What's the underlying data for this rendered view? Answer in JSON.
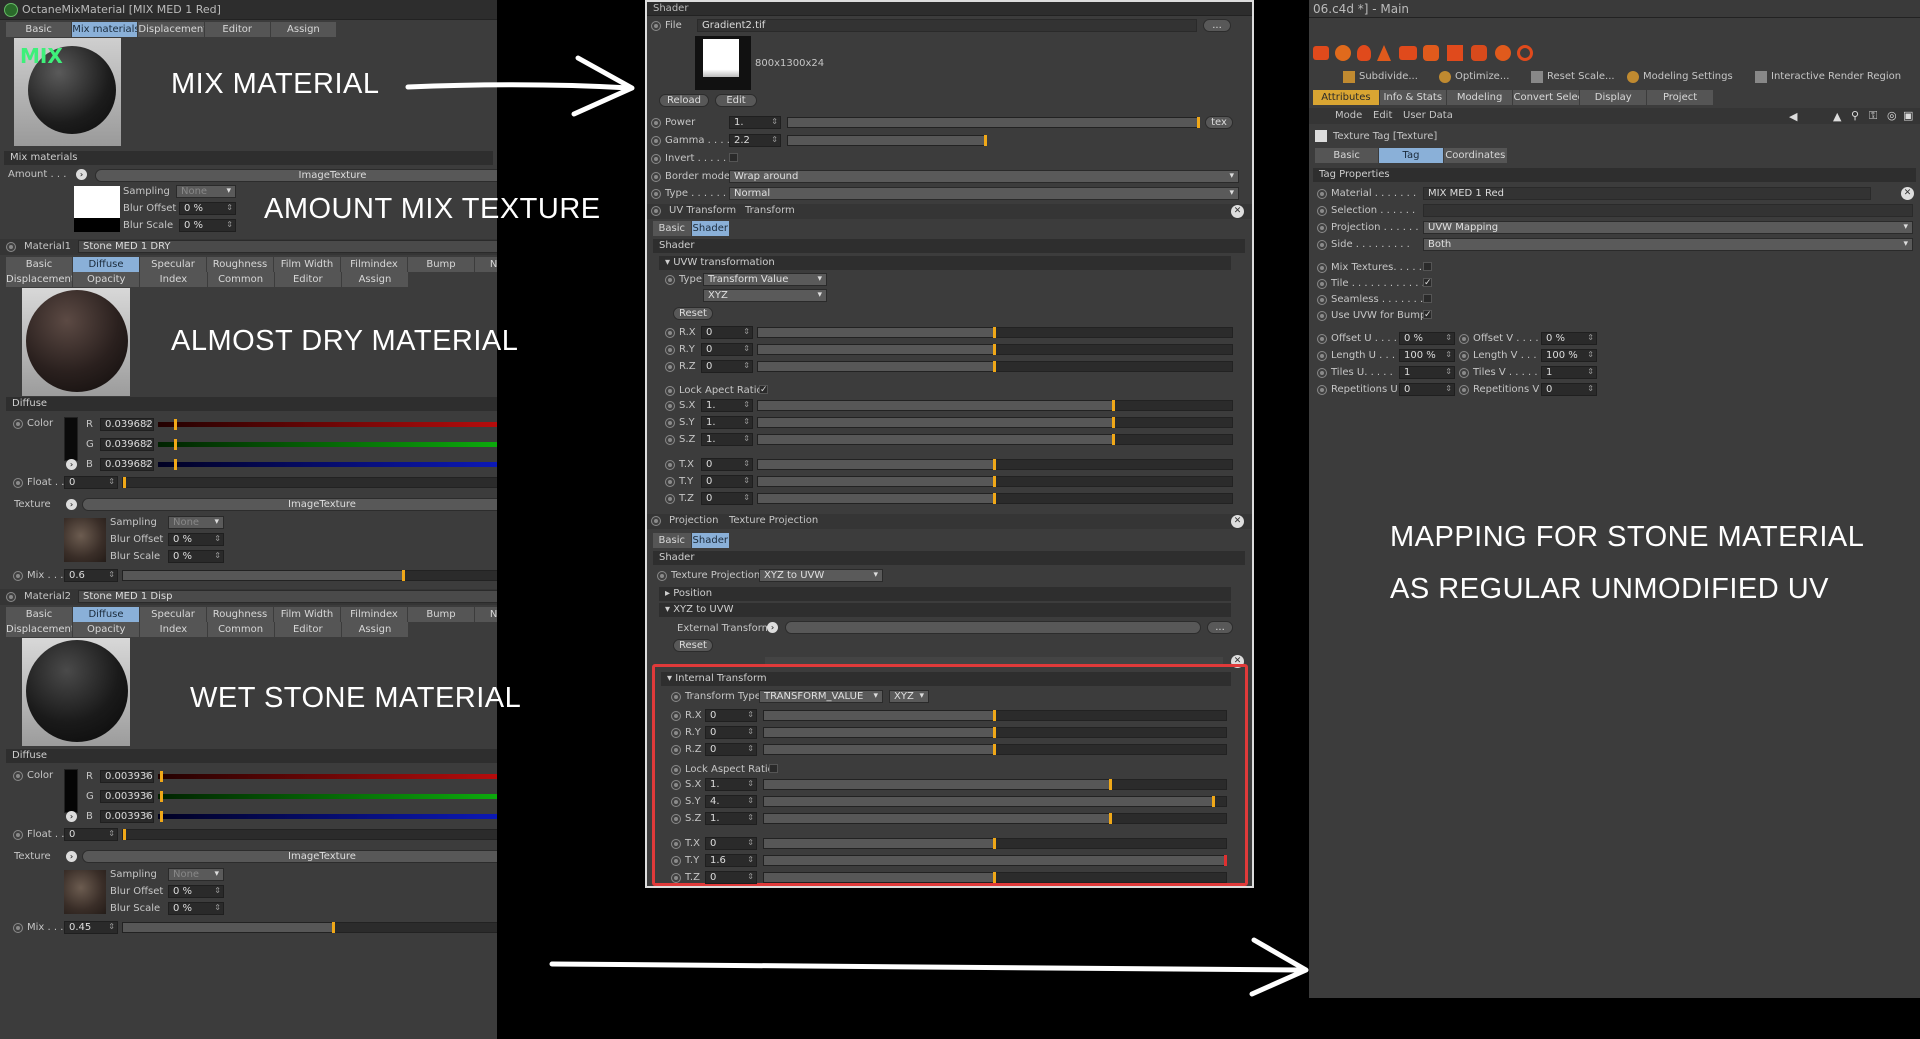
{
  "left_panel": {
    "title": "OctaneMixMaterial [MIX MED 1 Red]",
    "tabs": [
      "Basic",
      "Mix materials",
      "Displacement",
      "Editor",
      "Assign"
    ],
    "active_tab": "Mix materials",
    "preview_badge": "MIX",
    "section_mix": "Mix materials",
    "amount_label": "Amount . . .",
    "amount_texture": "ImageTexture",
    "amount_sampling_label": "Sampling",
    "amount_sampling_value": "None",
    "amount_blur_offset_label": "Blur Offset",
    "amount_blur_offset": "0 %",
    "amount_blur_scale_label": "Blur Scale",
    "amount_blur_scale": "0 %",
    "material1": {
      "label": "Material1",
      "name": "Stone MED 1 DRY",
      "tabs_row1": [
        "Basic",
        "Diffuse",
        "Specular",
        "Roughness",
        "Film Width",
        "Filmindex",
        "Bump",
        "Normal"
      ],
      "tabs_row2": [
        "Displacement",
        "Opacity",
        "Index",
        "Common",
        "Editor",
        "Assign"
      ],
      "section": "Diffuse",
      "color_label": "Color",
      "r": "0.039682",
      "g": "0.039682",
      "b": "0.039682",
      "float_label": "Float . .",
      "float_value": "0",
      "texture_label": "Texture",
      "texture_name": "ImageTexture",
      "sampling": "None",
      "blur_offset": "0 %",
      "blur_scale": "0 %",
      "mix_label": "Mix . . .",
      "mix_value": "0.6"
    },
    "material2": {
      "label": "Material2",
      "name": "Stone MED 1 Disp",
      "tabs_row1": [
        "Basic",
        "Diffuse",
        "Specular",
        "Roughness",
        "Film Width",
        "Filmindex",
        "Bump",
        "Normal"
      ],
      "tabs_row2": [
        "Displacement",
        "Opacity",
        "Index",
        "Common",
        "Editor",
        "Assign"
      ],
      "section": "Diffuse",
      "color_label": "Color",
      "r": "0.003936",
      "g": "0.003936",
      "b": "0.003936",
      "float_label": "Float . .",
      "float_value": "0",
      "texture_label": "Texture",
      "texture_name": "ImageTexture",
      "sampling": "None",
      "blur_offset": "0 %",
      "blur_scale": "0 %",
      "mix_label": "Mix . . .",
      "mix_value": "0.45"
    },
    "rgb_labels": [
      "R",
      "G",
      "B"
    ],
    "sampling_label": "Sampling",
    "blur_offset_label": "Blur Offset",
    "blur_scale_label": "Blur Scale"
  },
  "center_panel": {
    "title": "Shader",
    "file_label": "File",
    "file_name": "Gradient2.tif",
    "file_browse": "...",
    "image_size": "800x1300x24",
    "reload": "Reload",
    "edit": "Edit",
    "power_label": "Power",
    "power_value": "1.",
    "power_tex": "tex",
    "gamma_label": "Gamma . . . .",
    "gamma_value": "2.2",
    "invert_label": "Invert . . . . .",
    "border_label": "Border mode",
    "border_value": "Wrap around",
    "type_label": "Type . . . . . . .",
    "type_value": "Normal",
    "uv_transform_label": "UV Transform",
    "uv_transform_name": "Transform",
    "sub_tabs": [
      "Basic",
      "Shader"
    ],
    "shader_header": "Shader",
    "uvw_group": "UVW transformation",
    "uvw_type_label": "Type",
    "uvw_type_value": "Transform Value",
    "uvw_order": "XYZ",
    "reset": "Reset",
    "rotation": [
      {
        "label": "R.X",
        "value": "0"
      },
      {
        "label": "R.Y",
        "value": "0"
      },
      {
        "label": "R.Z",
        "value": "0"
      }
    ],
    "lock_aspect": "Lock Apect Ratio",
    "scale": [
      {
        "label": "S.X",
        "value": "1."
      },
      {
        "label": "S.Y",
        "value": "1."
      },
      {
        "label": "S.Z",
        "value": "1."
      }
    ],
    "translate": [
      {
        "label": "T.X",
        "value": "0"
      },
      {
        "label": "T.Y",
        "value": "0"
      },
      {
        "label": "T.Z",
        "value": "0"
      }
    ],
    "projection_label": "Projection",
    "projection_name": "Texture Projection",
    "tex_projection_label": "Texture Projection",
    "tex_projection_value": "XYZ to UVW",
    "position_group": "Position",
    "xyz_group": "XYZ to UVW",
    "external_transform": "External Transform",
    "internal_group": "Internal Transform",
    "transform_type_label": "Transform Type",
    "transform_type_value": "TRANSFORM_VALUE",
    "internal_order": "XYZ",
    "lock_aspect2": "Lock Aspect Ratio",
    "int_rotation": [
      {
        "label": "R.X",
        "value": "0"
      },
      {
        "label": "R.Y",
        "value": "0"
      },
      {
        "label": "R.Z",
        "value": "0"
      }
    ],
    "int_scale": [
      {
        "label": "S.X",
        "value": "1."
      },
      {
        "label": "S.Y",
        "value": "4."
      },
      {
        "label": "S.Z",
        "value": "1."
      }
    ],
    "int_translate": [
      {
        "label": "T.X",
        "value": "0"
      },
      {
        "label": "T.Y",
        "value": "1.6"
      },
      {
        "label": "T.Z",
        "value": "0"
      }
    ]
  },
  "right_panel": {
    "title": "06.c4d *] - Main",
    "toolbar": [
      "Subdivide...",
      "Optimize...",
      "Reset Scale...",
      "Modeling Settings",
      "Interactive Render Region"
    ],
    "tabs": [
      "Attributes",
      "Info & Stats",
      "Modeling",
      "Convert Selection",
      "Display",
      "Project"
    ],
    "menu": [
      "Mode",
      "Edit",
      "User Data"
    ],
    "object_title": "Texture Tag [Texture]",
    "tag_tabs": [
      "Basic",
      "Tag",
      "Coordinates"
    ],
    "active_tag_tab": "Tag",
    "section": "Tag Properties",
    "material_label": "Material . . . . . . .",
    "material_value": "MIX MED 1 Red",
    "selection_label": "Selection . . . . . .",
    "projection_label": "Projection . . . . . .",
    "projection_value": "UVW Mapping",
    "side_label": "Side . . . . . . . . .",
    "side_value": "Both",
    "mix_textures_label": "Mix Textures. . . . . .",
    "tile_label": "Tile . . . . . . . . . . . .",
    "seamless_label": "Seamless . . . . . . .",
    "use_uvw_label": "Use UVW for Bump",
    "offset_u_label": "Offset U . . . .",
    "offset_u": "0 %",
    "offset_v_label": "Offset V . . . .",
    "offset_v": "0 %",
    "length_u_label": "Length U . . .",
    "length_u": "100 %",
    "length_v_label": "Length V . . .",
    "length_v": "100 %",
    "tiles_u_label": "Tiles U. . . . .",
    "tiles_u": "1",
    "tiles_v_label": "Tiles V . . . . .",
    "tiles_v": "1",
    "reps_u_label": "Repetitions U",
    "reps_u": "0",
    "reps_v_label": "Repetitions V",
    "reps_v": "0"
  },
  "annotations": {
    "mix_material": "MIX MATERIAL",
    "amount_mix": "AMOUNT MIX TEXTURE",
    "almost_dry": "ALMOST DRY MATERIAL",
    "wet_stone": "WET STONE MATERIAL",
    "mapping_line1": "MAPPING FOR STONE MATERIAL",
    "mapping_line2": "AS REGULAR UNMODIFIED UV"
  },
  "colors": {
    "panel": "#3c3c3c",
    "active_tab": "#8ab0d8",
    "slider_knob": "#f0a818",
    "highlight_box": "#e03a3a"
  }
}
